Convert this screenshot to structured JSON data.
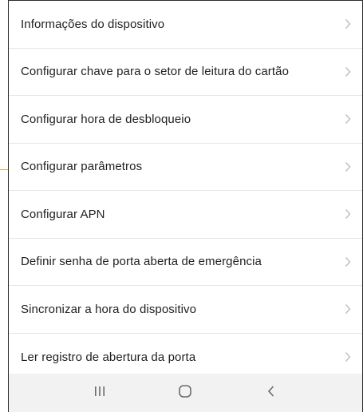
{
  "menu": {
    "items": [
      {
        "label": "Informações do dispositivo"
      },
      {
        "label": "Configurar chave para o setor de leitura do cartão"
      },
      {
        "label": "Configurar hora de desbloqueio"
      },
      {
        "label": "Configurar parâmetros"
      },
      {
        "label": "Configurar APN"
      },
      {
        "label": "Definir senha de porta aberta de emergência"
      },
      {
        "label": "Sincronizar a hora do dispositivo"
      },
      {
        "label": "Ler registro de abertura da porta"
      }
    ],
    "chevron_icon": "chevron-right-icon"
  },
  "navbar": {
    "buttons": [
      {
        "icon": "recent-apps-icon"
      },
      {
        "icon": "home-icon"
      },
      {
        "icon": "back-icon"
      }
    ]
  },
  "colors": {
    "text": "#1f1f1f",
    "divider": "#e6e6e6",
    "chevron": "#bdbdbd",
    "navbar_bg": "#f2f2f2",
    "nav_icon": "#6b6b6b",
    "callout_line": "#e8a33a"
  }
}
